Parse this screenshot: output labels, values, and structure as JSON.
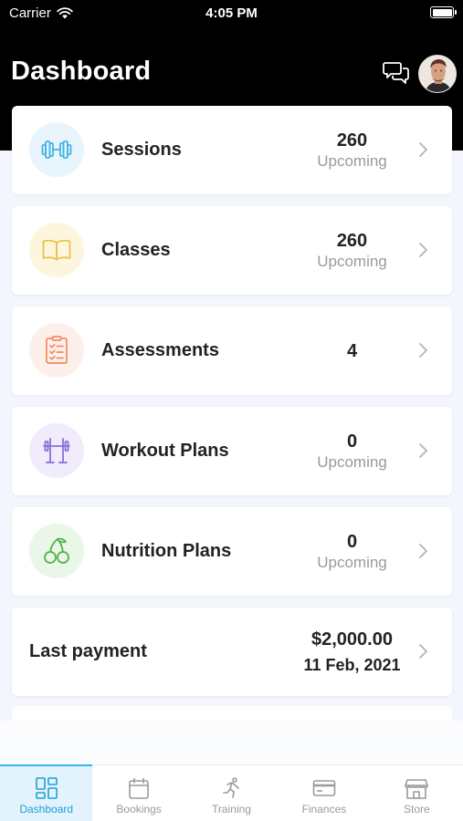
{
  "status_bar": {
    "carrier": "Carrier",
    "time": "4:05 PM"
  },
  "header": {
    "title": "Dashboard",
    "chat_icon": "chat-bubbles-icon",
    "avatar": "user-avatar"
  },
  "colors": {
    "header_bg": "#000000",
    "page_bg": "#f3f6fc",
    "accent": "#1e9fd8",
    "sessions_icon": "#45b3e6",
    "classes_icon": "#e8c24a",
    "assessments_icon": "#f08a62",
    "workout_icon": "#8b6fd6",
    "nutrition_icon": "#53b34a"
  },
  "cards": [
    {
      "key": "sessions",
      "label": "Sessions",
      "count": "260",
      "sub": "Upcoming",
      "icon": "dumbbell-icon"
    },
    {
      "key": "classes",
      "label": "Classes",
      "count": "260",
      "sub": "Upcoming",
      "icon": "book-icon"
    },
    {
      "key": "assessments",
      "label": "Assessments",
      "count": "4",
      "sub": "",
      "icon": "checklist-icon"
    },
    {
      "key": "workout_plans",
      "label": "Workout Plans",
      "count": "0",
      "sub": "Upcoming",
      "icon": "barbell-rack-icon"
    },
    {
      "key": "nutrition_plans",
      "label": "Nutrition Plans",
      "count": "0",
      "sub": "Upcoming",
      "icon": "cherries-icon"
    }
  ],
  "payment": {
    "label": "Last payment",
    "amount": "$2,000.00",
    "date": "11 Feb, 2021"
  },
  "tabs": [
    {
      "label": "Dashboard",
      "icon": "dashboard-icon",
      "active": true
    },
    {
      "label": "Bookings",
      "icon": "calendar-icon",
      "active": false
    },
    {
      "label": "Training",
      "icon": "running-icon",
      "active": false
    },
    {
      "label": "Finances",
      "icon": "credit-card-icon",
      "active": false
    },
    {
      "label": "Store",
      "icon": "store-icon",
      "active": false
    }
  ]
}
